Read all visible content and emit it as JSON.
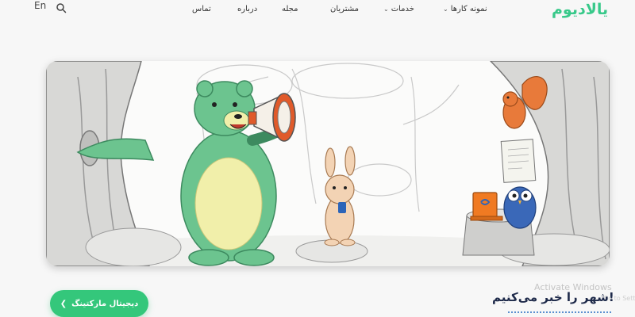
{
  "header": {
    "logo": "یالادیوم",
    "lang": "En",
    "nav": [
      {
        "label": "نمونه کارها",
        "dropdown": true
      },
      {
        "label": "خدمات",
        "dropdown": true
      },
      {
        "label": "مشتریان",
        "dropdown": false
      },
      {
        "label": "مجله",
        "dropdown": false
      },
      {
        "label": "درباره",
        "dropdown": false
      },
      {
        "label": "تماس",
        "dropdown": false
      }
    ]
  },
  "hero": {
    "illustration": "bear-megaphone-rabbit-owl-squirrel-forest"
  },
  "cta": {
    "label": "دیجیتال مارکتینگ"
  },
  "headline": "شهر را خبر می‌کنیم!",
  "watermark": {
    "line1": "Activate Windows",
    "line2": "Go to Settings"
  },
  "colors": {
    "accent": "#34c77b",
    "logo": "#38c98a",
    "headline": "#1e2a4a"
  },
  "icons": {
    "search": "search-icon",
    "chevron": "chevron-down-icon",
    "cta_arrow": "chevron-left-icon"
  }
}
